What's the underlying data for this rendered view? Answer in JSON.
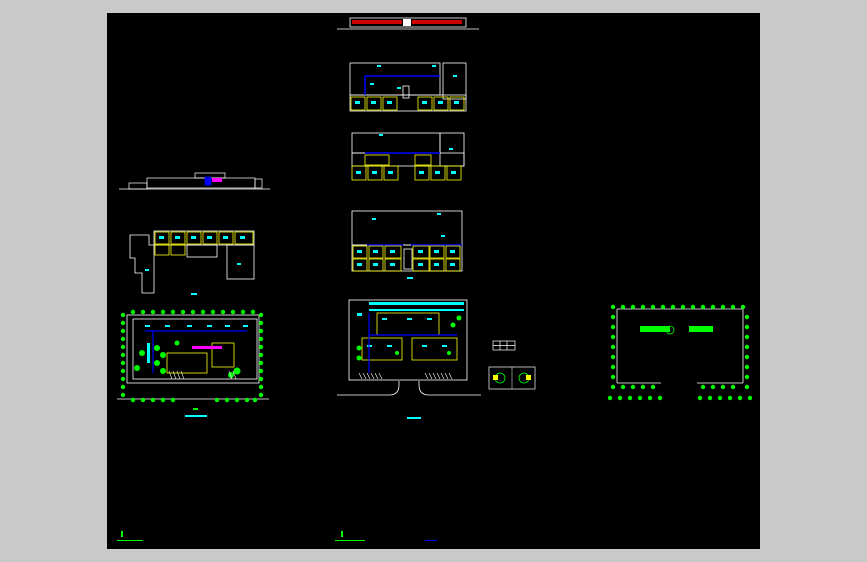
{
  "viewer": {
    "background": "#c9c9c9",
    "canvas_color": "#000000"
  },
  "colors": {
    "wall": "#ffffff",
    "room_outline": "#ffff00",
    "room_tag": "#00ffff",
    "tree": "#00ff00",
    "corridor": "#0000ff",
    "accent_red": "#ff0000",
    "accent_magenta": "#ff00ff"
  },
  "drawings": [
    {
      "id": "elevation-top",
      "kind": "elevation"
    },
    {
      "id": "elevation-left",
      "kind": "elevation"
    },
    {
      "id": "floor-plan-1",
      "kind": "floor-plan"
    },
    {
      "id": "floor-plan-2",
      "kind": "floor-plan"
    },
    {
      "id": "floor-plan-3",
      "kind": "floor-plan"
    },
    {
      "id": "floor-plan-left",
      "kind": "floor-plan"
    },
    {
      "id": "site-plan-left",
      "kind": "site-plan"
    },
    {
      "id": "site-plan-center",
      "kind": "site-plan"
    },
    {
      "id": "window-detail",
      "kind": "detail"
    },
    {
      "id": "court-detail",
      "kind": "detail"
    },
    {
      "id": "site-plan-right",
      "kind": "site-plan"
    }
  ]
}
